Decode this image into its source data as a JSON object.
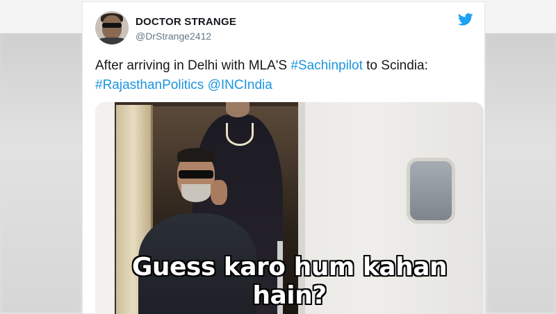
{
  "tweet": {
    "display_name": "DOCTOR STRANGE",
    "handle": "@DrStrange2412",
    "text_line1_plain": "After arriving in Delhi with MLA'S ",
    "hashtag_sachinpilot": "#Sachinpilot",
    "text_line1_tail": " to Scindia:",
    "hashtag_rajasthan": "#RajasthanPolitics",
    "mention_inc": "@INCIndia",
    "link_color": "#1b95e0"
  },
  "media": {
    "caption": "Guess karo hum kahan hain?"
  },
  "icons": {
    "brand": "twitter-bird-icon",
    "brand_color": "#1da1f2"
  }
}
